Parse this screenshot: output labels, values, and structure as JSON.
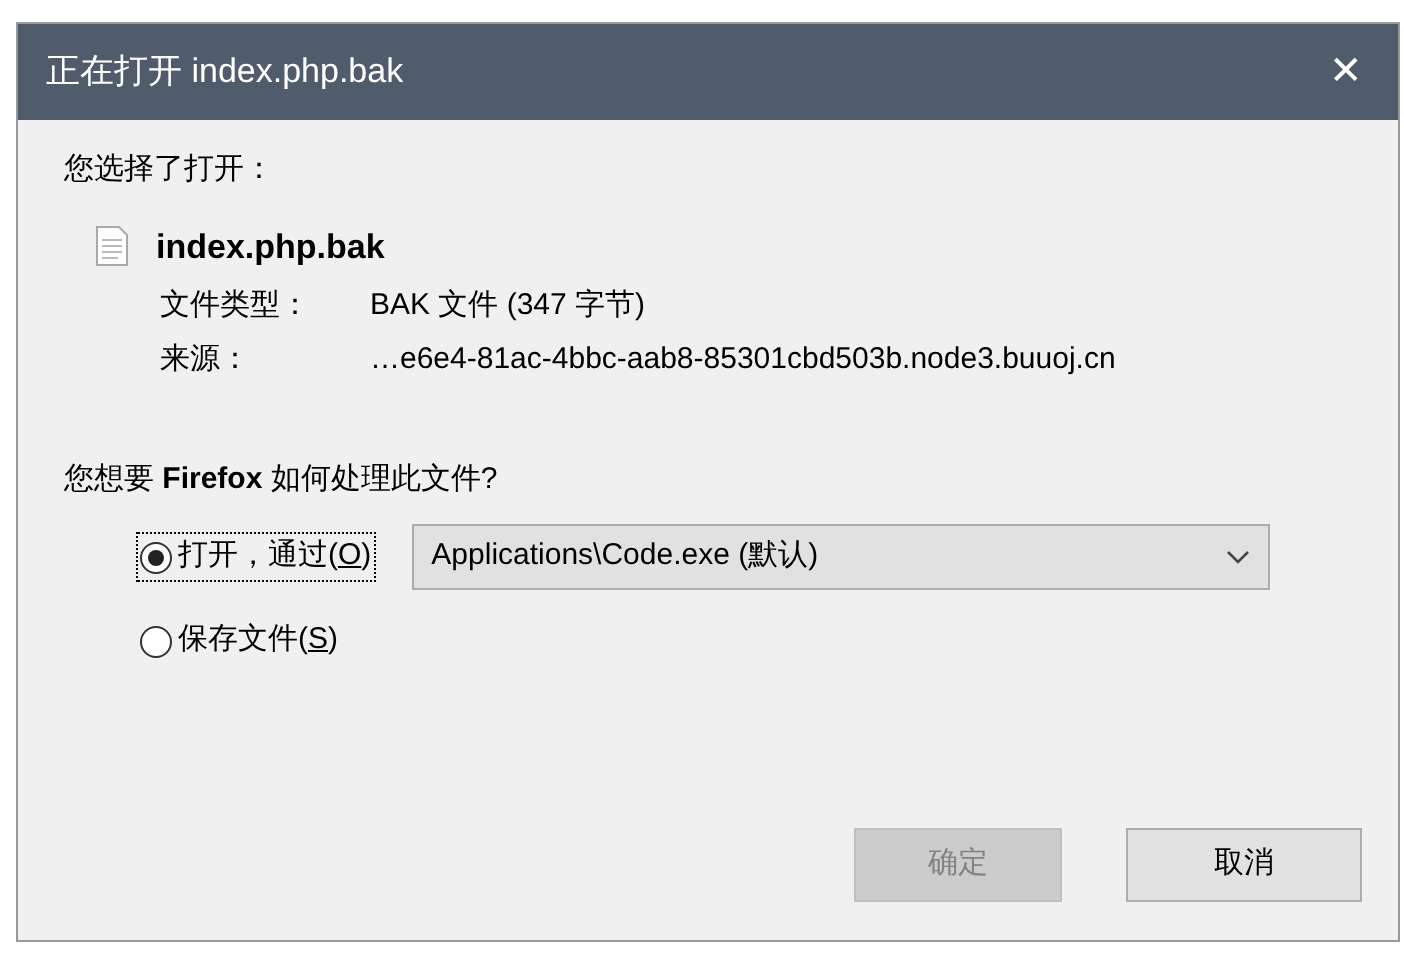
{
  "window": {
    "title": "正在打开 index.php.bak",
    "close": "✕"
  },
  "intro": "您选择了打开：",
  "file": {
    "name": "index.php.bak",
    "details": [
      {
        "label": "文件类型：",
        "value": "BAK 文件 (347 字节)"
      },
      {
        "label": "来源：",
        "value": "…e6e4-81ac-4bbc-aab8-85301cbd503b.node3.buuoj.cn"
      }
    ]
  },
  "question": "您想要 **Firefox** 如何处理此文件?",
  "options": [
    {
      "label_prefix": "打开，通过(",
      "access_key": "O",
      "label_suffix": ")",
      "selected": true,
      "focused": true,
      "dropdown": {
        "value": "Applications\\Code.exe (默认)"
      }
    },
    {
      "label_prefix": "保存文件(",
      "access_key": "S",
      "label_suffix": ")",
      "selected": false,
      "focused": false
    }
  ],
  "buttons": [
    {
      "label": "确定",
      "disabled": true
    },
    {
      "label": "取消",
      "disabled": false
    }
  ]
}
